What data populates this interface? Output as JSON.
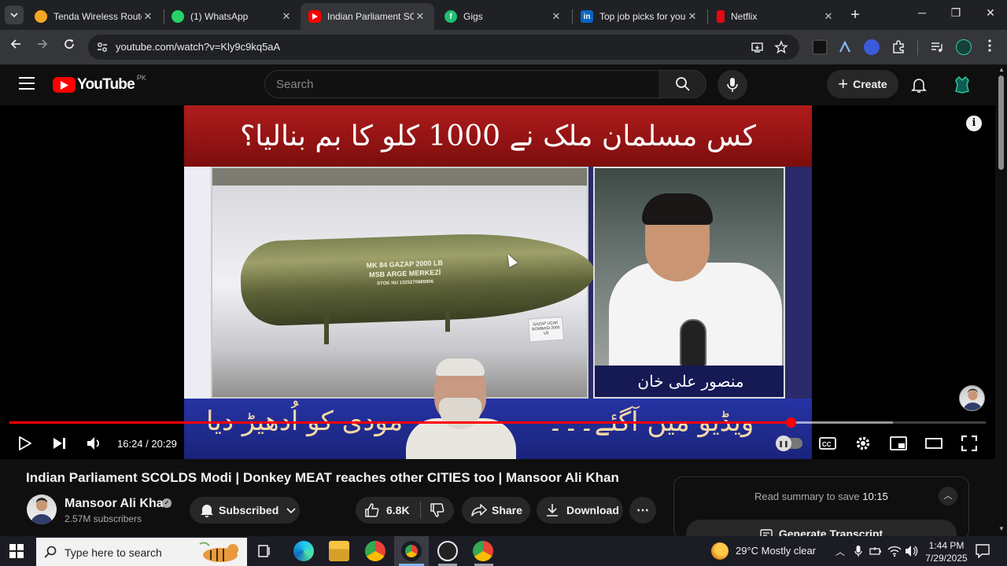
{
  "browser": {
    "tabs": [
      {
        "title": "Tenda Wireless Route",
        "favicon_color": "#f5a623"
      },
      {
        "title": "(1) WhatsApp",
        "favicon_color": "#25d366"
      },
      {
        "title": "Indian Parliament SCC",
        "favicon_color": "#ff0000",
        "active": true
      },
      {
        "title": "Gigs",
        "favicon_color": "#1dbf73"
      },
      {
        "title": "Top job picks for you",
        "favicon_color": "#0a66c2"
      },
      {
        "title": "Netflix",
        "favicon_color": "#e50914"
      }
    ],
    "close_glyph": "✕",
    "new_tab_glyph": "+",
    "window_controls": {
      "minimize": "─",
      "maximize": "❐",
      "close": "✕"
    },
    "url": "youtube.com/watch?v=Kly9c9kq5aA"
  },
  "youtube": {
    "country_code": "PK",
    "logo_text": "YouTube",
    "search_placeholder": "Search",
    "create_label": "Create"
  },
  "video": {
    "headline_urdu": "کس مسلمان ملک نے 1000 کلو کا بم بنالیا؟",
    "anchor_name_urdu": "منصور علی خان",
    "ticker_left_urdu": "مودی کو اُدھیڑ دیا",
    "ticker_right_urdu": "ویڈیو میں آگئے۔۔۔",
    "bomb_text_lines": [
      "MK 84 GAZAP 2000 LB",
      "MSB ARGE MERKEZİ",
      "STOK NU 1325270685906"
    ],
    "plaque_text": "GAZAP UÇAK BOMBASI 2000 LB",
    "info_glyph": "i",
    "time_current": "16:24",
    "time_total": "20:29",
    "time_display": "16:24 / 20:29",
    "progress_fraction": 0.8003,
    "buffer_fraction": 0.905,
    "title": "Indian Parliament SCOLDS Modi | Donkey MEAT reaches other CITIES too | Mansoor Ali Khan",
    "channel_name": "Mansoor Ali Khan",
    "subscribers": "2.57M subscribers",
    "subscribed_label": "Subscribed",
    "likes": "6.8K",
    "share_label": "Share",
    "download_label": "Download",
    "more_glyph": "⋯",
    "verified_glyph": "✓"
  },
  "summary": {
    "prefix": "Read summary to save ",
    "time_saved": "10:15",
    "button_label": "Generate Transcript",
    "collapse_glyph": "︿"
  },
  "taskbar": {
    "search_placeholder": "Type here to search",
    "weather": "29°C  Mostly clear",
    "time": "1:44 PM",
    "date": "7/29/2025",
    "tray_chevron": "︿"
  },
  "colors": {
    "accent_red": "#ff0000",
    "youtube_bg": "#0f0f0f",
    "chrome_tab_bg": "#202124",
    "chrome_toolbar": "#35363a"
  },
  "icons": [
    "search-icon",
    "mic-icon",
    "bell-icon",
    "play-icon",
    "next-icon",
    "volume-icon",
    "captions-icon",
    "settings-icon",
    "miniplayer-icon",
    "theater-icon",
    "fullscreen-icon",
    "like-icon",
    "dislike-icon",
    "share-icon",
    "download-icon",
    "windows-logo-icon"
  ]
}
